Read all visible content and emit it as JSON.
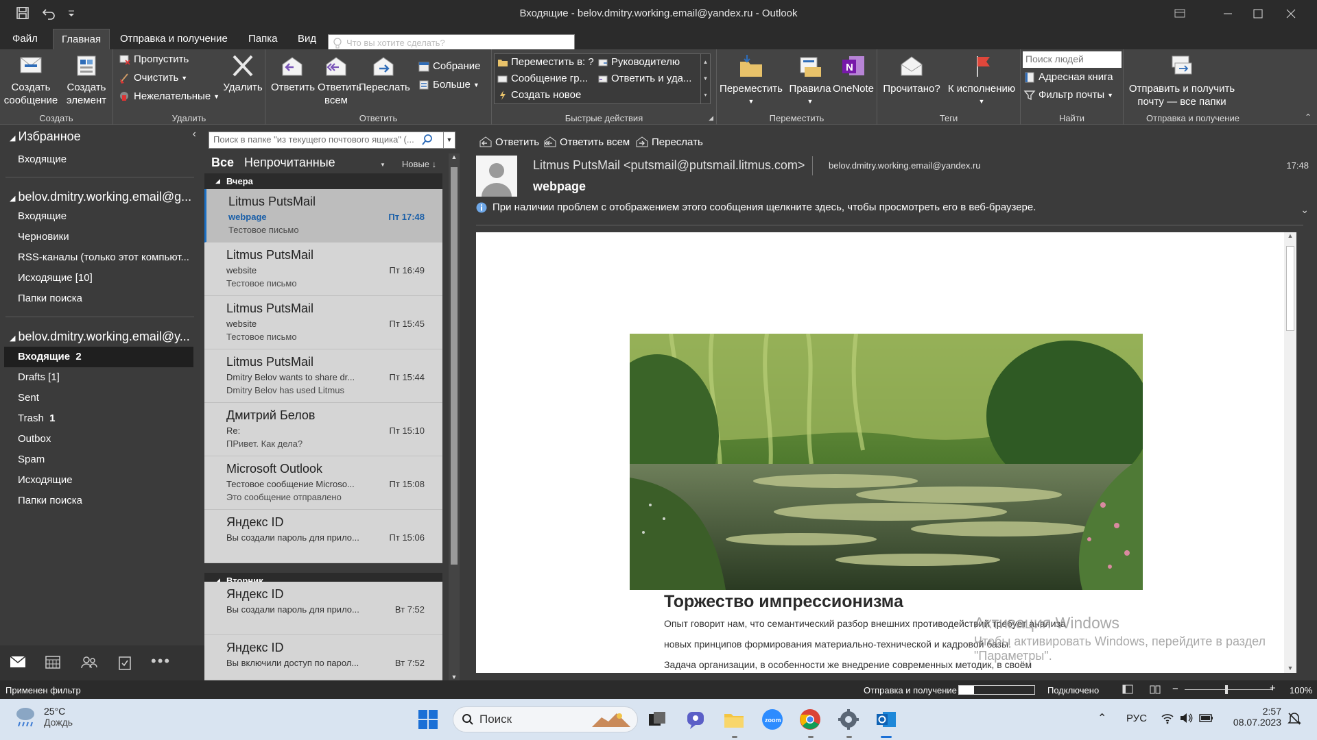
{
  "window": {
    "title": "Входящие - belov.dmitry.working.email@yandex.ru - Outlook"
  },
  "menu": {
    "tabs": [
      "Файл",
      "Главная",
      "Отправка и получение",
      "Папка",
      "Вид"
    ],
    "tell_me": "Что вы хотите сделать?"
  },
  "ribbon": {
    "create": {
      "new_email": "Создать сообщение",
      "new_item": "Создать элемент",
      "label": "Создать"
    },
    "delete": {
      "ignore": "Пропустить",
      "clean": "Очистить",
      "junk": "Нежелательные",
      "delete": "Удалить",
      "label": "Удалить"
    },
    "respond": {
      "reply": "Ответить",
      "reply_all": "Ответить всем",
      "forward": "Переслать",
      "meeting": "Собрание",
      "more": "Больше",
      "label": "Ответить"
    },
    "quicksteps": {
      "move_to": "Переместить в: ?",
      "to_manager": "Руководителю",
      "team_email": "Сообщение гр...",
      "reply_delete": "Ответить и уда...",
      "create_new": "Создать новое",
      "label": "Быстрые действия"
    },
    "move": {
      "move": "Переместить",
      "rules": "Правила",
      "onenote": "OneNote",
      "label": "Переместить"
    },
    "tags": {
      "read": "Прочитано?",
      "followup": "К исполнению",
      "label": "Теги"
    },
    "find": {
      "people_placeholder": "Поиск людей",
      "address_book": "Адресная книга",
      "filter_email": "Фильтр почты",
      "label": "Найти"
    },
    "sendreceive": {
      "send_all": "Отправить и получить почту — все папки",
      "label": "Отправка и получение"
    }
  },
  "nav": {
    "favorites": "Избранное",
    "fav_inbox": "Входящие",
    "account1": "belov.dmitry.working.email@g...",
    "account1_items": [
      "Входящие",
      "Черновики",
      "RSS-каналы (только этот компьют...",
      "Исходящие [10]",
      "Папки поиска"
    ],
    "account2": "belov.dmitry.working.email@y...",
    "account2_items": [
      {
        "label": "Входящие",
        "count": "2",
        "selected": true
      },
      {
        "label": "Drafts [1]",
        "count": ""
      },
      {
        "label": "Sent",
        "count": ""
      },
      {
        "label": "Trash",
        "count": "1"
      },
      {
        "label": "Outbox",
        "count": ""
      },
      {
        "label": "Spam",
        "count": ""
      },
      {
        "label": "Исходящие",
        "count": ""
      },
      {
        "label": "Папки поиска",
        "count": ""
      }
    ]
  },
  "list": {
    "search_placeholder": "Поиск в папке \"из текущего почтового ящика\" (...",
    "filter_all": "Все",
    "filter_unread": "Непрочитанные",
    "sort": "Новые",
    "groups": [
      "Вчера",
      "Вторник"
    ],
    "messages": [
      {
        "from": "Litmus PutsMail",
        "subject": "webpage",
        "preview": "Тестовое письмо",
        "time": "Пт 17:48",
        "selected": true
      },
      {
        "from": "Litmus PutsMail",
        "subject": "website",
        "preview": "Тестовое письмо",
        "time": "Пт 16:49"
      },
      {
        "from": "Litmus PutsMail",
        "subject": "website",
        "preview": "Тестовое письмо",
        "time": "Пт 15:45"
      },
      {
        "from": "Litmus PutsMail",
        "subject": "Dmitry Belov wants to share dr...",
        "preview": "Dmitry Belov has used Litmus",
        "time": "Пт 15:44"
      },
      {
        "from": "Дмитрий Белов",
        "subject": "Re:",
        "preview": "ПРивет. Как дела?",
        "time": "Пт 15:10"
      },
      {
        "from": "Microsoft Outlook",
        "subject": "Тестовое сообщение Microso...",
        "preview": "Это сообщение отправлено",
        "time": "Пт 15:08"
      },
      {
        "from": "Яндекс ID",
        "subject": "Вы создали пароль для прило...",
        "preview": "",
        "time": "Пт 15:06"
      },
      {
        "from": "Яндекс ID",
        "subject": "Вы создали пароль для прило...",
        "preview": "",
        "time": "Вт 7:52"
      },
      {
        "from": "Яндекс ID",
        "subject": "Вы включили доступ по парол...",
        "preview": "",
        "time": "Вт 7:52"
      }
    ]
  },
  "reading": {
    "reply": "Ответить",
    "reply_all": "Ответить всем",
    "forward": "Переслать",
    "from": "Litmus PutsMail <putsmail@putsmail.litmus.com>",
    "to": "belov.dmitry.working.email@yandex.ru",
    "time": "17:48",
    "subject": "webpage",
    "info": "При наличии проблем с отображением этого сообщения щелкните здесь, чтобы просмотреть его в веб-браузере.",
    "heading": "Торжество импрессионизма",
    "paragraphs": [
      "Опыт говорит нам, что семантический разбор внешних противодействий требует анализа",
      "новых принципов формирования материально-технической и кадровой базы.",
      "Задача организации, в особенности же внедрение современных методик, в своём"
    ],
    "watermark_title": "Активация Windows",
    "watermark_text": "Чтобы активировать Windows, перейдите в раздел \"Параметры\"."
  },
  "status": {
    "left": "Применен фильтр",
    "send_receive": "Отправка и получение",
    "connected": "Подключено",
    "zoom": "100%"
  },
  "taskbar": {
    "weather_temp": "25°C",
    "weather_desc": "Дождь",
    "search": "Поиск",
    "lang": "РУС",
    "time": "2:57",
    "date": "08.07.2023"
  },
  "colors": {
    "accent": "#1a6fc4",
    "followup_flag": "#e0473b",
    "onenote": "#7719aa"
  }
}
